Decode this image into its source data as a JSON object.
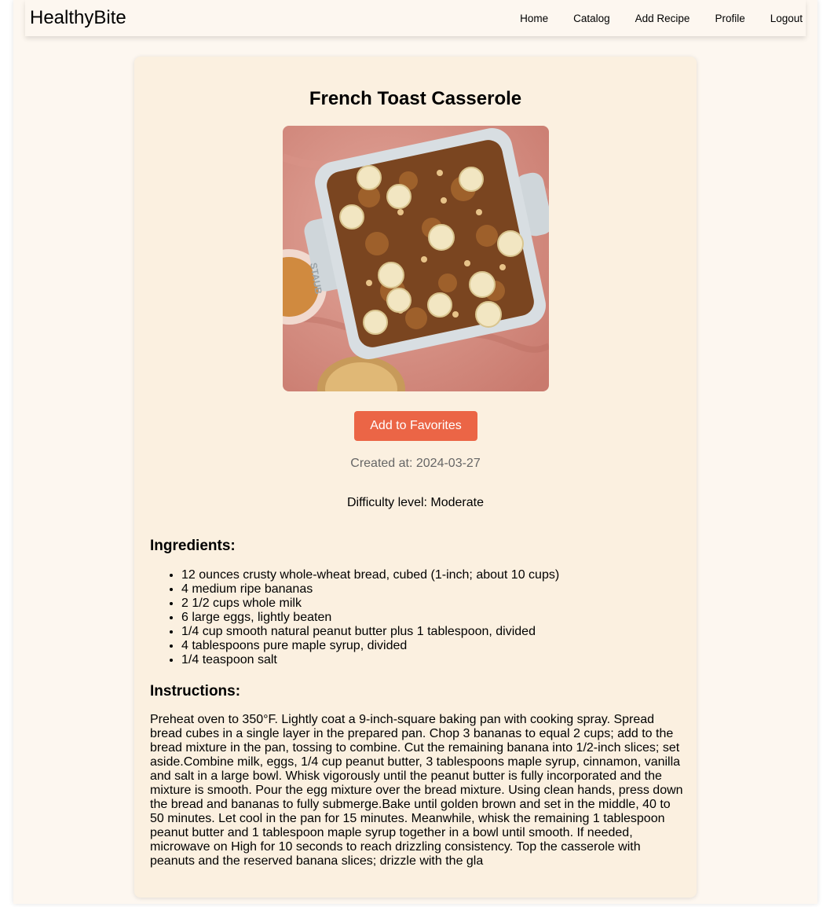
{
  "nav": {
    "brand": "HealthyBite",
    "links": [
      "Home",
      "Catalog",
      "Add Recipe",
      "Profile",
      "Logout"
    ]
  },
  "recipe": {
    "title": "French Toast Casserole",
    "image_alt": "French Toast Casserole",
    "favorite_button": "Add to Favorites",
    "created_at": "Created at: 2024-03-27",
    "difficulty": "Difficulty level: Moderate",
    "ingredients_heading": "Ingredients:",
    "ingredients": [
      "12 ounces crusty whole-wheat bread, cubed (1-inch; about 10 cups)",
      "4 medium ripe bananas",
      "2 1/2 cups whole milk",
      "6 large eggs, lightly beaten",
      "1/4 cup smooth natural peanut butter plus 1 tablespoon, divided",
      "4 tablespoons pure maple syrup, divided",
      "1/4 teaspoon salt"
    ],
    "instructions_heading": "Instructions:",
    "instructions": "Preheat oven to 350°F. Lightly coat a 9-inch-square baking pan with cooking spray. Spread bread cubes in a single layer in the prepared pan. Chop 3 bananas to equal 2 cups; add to the bread mixture in the pan, tossing to combine. Cut the remaining banana into 1/2-inch slices; set aside.Combine milk, eggs, 1/4 cup peanut butter, 3 tablespoons maple syrup, cinnamon, vanilla and salt in a large bowl. Whisk vigorously until the peanut butter is fully incorporated and the mixture is smooth. Pour the egg mixture over the bread mixture. Using clean hands, press down the bread and bananas to fully submerge.Bake until golden brown and set in the middle, 40 to 50 minutes. Let cool in the pan for 15 minutes. Meanwhile, whisk the remaining 1 tablespoon peanut butter and 1 tablespoon maple syrup together in a bowl until smooth. If needed, microwave on High for 10 seconds to reach drizzling consistency. Top the casserole with peanuts and the reserved banana slices; drizzle with the gla"
  },
  "colors": {
    "page_bg": "#fdf7f0",
    "card_bg": "#fbf0e0",
    "accent_button": "#eb6546"
  }
}
